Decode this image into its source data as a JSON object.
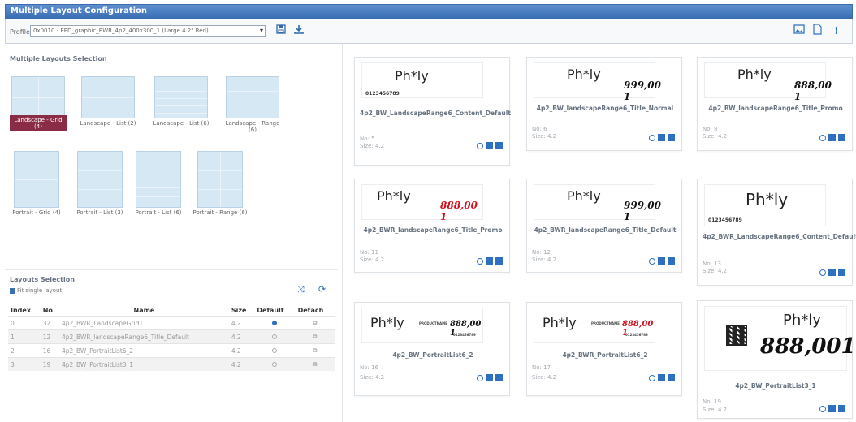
{
  "window": {
    "title": "Multiple Layout Configuration"
  },
  "toolbar": {
    "profile_label": "Profile",
    "profile_value": "0x0010 - EPD_graphic_BWR_4p2_400x300_1 (Large 4.2\" Red)",
    "save_icon": "floppy-disk-icon",
    "download_icon": "download-icon",
    "right_icons": [
      "image-icon",
      "page-icon",
      "info-icon"
    ]
  },
  "layouts_selection_title": "Multiple Layouts Selection",
  "layout_options": [
    {
      "label": "Landscape - Grid (4)",
      "active": true
    },
    {
      "label": "Landscape - List (2)",
      "active": false
    },
    {
      "label": "Landscape - List (6)",
      "active": false
    },
    {
      "label": "Landscape - Range (6)",
      "active": false
    },
    {
      "label": "Portrait - Grid (4)",
      "active": false
    },
    {
      "label": "Portrait - List (3)",
      "active": false
    },
    {
      "label": "Portrait - List (6)",
      "active": false
    },
    {
      "label": "Portrait - Range (6)",
      "active": false
    }
  ],
  "layouts_table": {
    "title": "Layouts Selection",
    "fit_label": "Fit single layout",
    "columns": [
      "Index",
      "No",
      "Name",
      "Size",
      "Default",
      "Detach"
    ],
    "rows": [
      {
        "index": "0",
        "no": "32",
        "name": "4p2_BWR_LandscapeGrid1",
        "size": "4.2",
        "default": true
      },
      {
        "index": "1",
        "no": "12",
        "name": "4p2_BWR_landscapeRange6_Title_Default",
        "size": "4.2",
        "default": false
      },
      {
        "index": "2",
        "no": "16",
        "name": "4p2_BW_PortraitList6_2",
        "size": "4.2",
        "default": false
      },
      {
        "index": "3",
        "no": "19",
        "name": "4p2_BW_PortraitList3_1",
        "size": "4.2",
        "default": false
      }
    ]
  },
  "label_common": {
    "product": "Ph*ly",
    "barcode": "0123456789",
    "brand": "PRODUCTNAME"
  },
  "cards": [
    {
      "title": "4p2_BW_LandscapeRange6_Content_Default",
      "no": "No: 5",
      "size": "Size: 4.2",
      "price": "",
      "red": false
    },
    {
      "title": "4p2_BW_landscapeRange6_Title_Normal",
      "no": "No: 6",
      "size": "Size: 4.2",
      "price": "999,00 1",
      "red": false
    },
    {
      "title": "4p2_BW_landscapeRange6_Title_Promo",
      "no": "No: 8",
      "size": "Size: 4.2",
      "price": "888,00 1",
      "red": false
    },
    {
      "title": "4p2_BWR_landscapeRange6_Title_Promo",
      "no": "No: 11",
      "size": "Size: 4.2",
      "price": "888,00 1",
      "red": true
    },
    {
      "title": "4p2_BWR_landscapeRange6_Title_Default",
      "no": "No: 12",
      "size": "Size: 4.2",
      "price": "999,00 1",
      "red": false
    },
    {
      "title": "4p2_BWR_LandscapeRange6_Content_Default",
      "no": "No: 13",
      "size": "Size: 4.2",
      "price": "",
      "red": false
    },
    {
      "title": "4p2_BW_PortraitList6_2",
      "no": "No: 16",
      "size": "Size: 4.2",
      "price": "888,00 1",
      "red": false
    },
    {
      "title": "4p2_BWR_PortraitList6_2",
      "no": "No: 17",
      "size": "Size: 4.2",
      "price": "888,00 1",
      "red": true
    },
    {
      "title": "4p2_BW_PortraitList3_1",
      "no": "No: 19",
      "size": "Size: 4.2",
      "price": "888,001",
      "red": false
    }
  ],
  "colors": {
    "titlebar": "#3b6fb5",
    "accent": "#2f6fc0",
    "active_layout": "#8a2c45",
    "promo_red": "#d0111d"
  }
}
